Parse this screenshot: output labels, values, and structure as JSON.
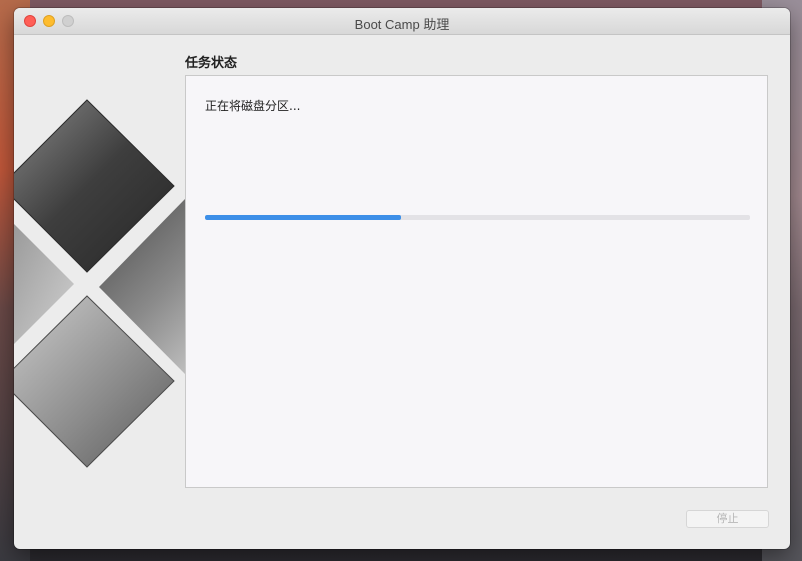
{
  "window": {
    "title": "Boot Camp 助理"
  },
  "section": {
    "title": "任务状态"
  },
  "status": {
    "message": "正在将磁盘分区...",
    "progress": 0.36
  },
  "buttons": {
    "stop_label": "停止"
  },
  "colors": {
    "progress": "#3d8fe8",
    "close": "#ff5f57",
    "minimize": "#febc2e"
  }
}
